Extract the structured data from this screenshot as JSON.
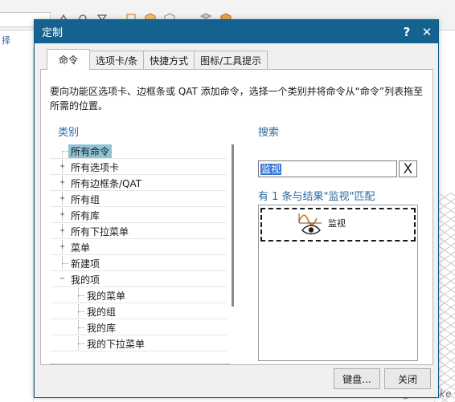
{
  "background": {
    "tab_text": "择",
    "watermark": "UG爱好者论坛@IThacke"
  },
  "dialog": {
    "title": "定制",
    "help_label": "?",
    "close_label": "✕",
    "tabs": [
      {
        "label": "命令",
        "active": true
      },
      {
        "label": "选项卡/条",
        "active": false
      },
      {
        "label": "快捷方式",
        "active": false
      },
      {
        "label": "图标/工具提示",
        "active": false
      }
    ],
    "description": "要向功能区选项卡、边框条或 QAT 添加命令，选择一个类别并将命令从“命令”列表拖至所需的位置。",
    "category_label": "类别",
    "categories": [
      {
        "label": "所有命令",
        "expander": "",
        "selected": true
      },
      {
        "label": "所有选项卡",
        "expander": "+"
      },
      {
        "label": "所有边框条/QAT",
        "expander": "+"
      },
      {
        "label": "所有组",
        "expander": "+"
      },
      {
        "label": "所有库",
        "expander": "+"
      },
      {
        "label": "所有下拉菜单",
        "expander": "+"
      },
      {
        "label": "菜单",
        "expander": "+"
      },
      {
        "label": "新建项",
        "expander": ""
      },
      {
        "label": "我的项",
        "expander": "−"
      },
      {
        "label": "我的菜单",
        "expander": ""
      },
      {
        "label": "我的组",
        "expander": ""
      },
      {
        "label": "我的库",
        "expander": ""
      },
      {
        "label": "我的下拉菜单",
        "expander": ""
      }
    ],
    "search_label": "搜索",
    "search_value": "监视",
    "clear_label": "X",
    "result_summary": "有 1 条与结果\"监视\"匹配",
    "results": [
      {
        "label": "监视",
        "icon": "monitor-icon"
      }
    ],
    "keyboard_button": "键盘...",
    "close_button": "关闭"
  },
  "colors": {
    "titlebar": "#14628f",
    "accent_text": "#2b6a9e",
    "selection": "#8fc4d8",
    "search_highlight": "#3875d7"
  }
}
